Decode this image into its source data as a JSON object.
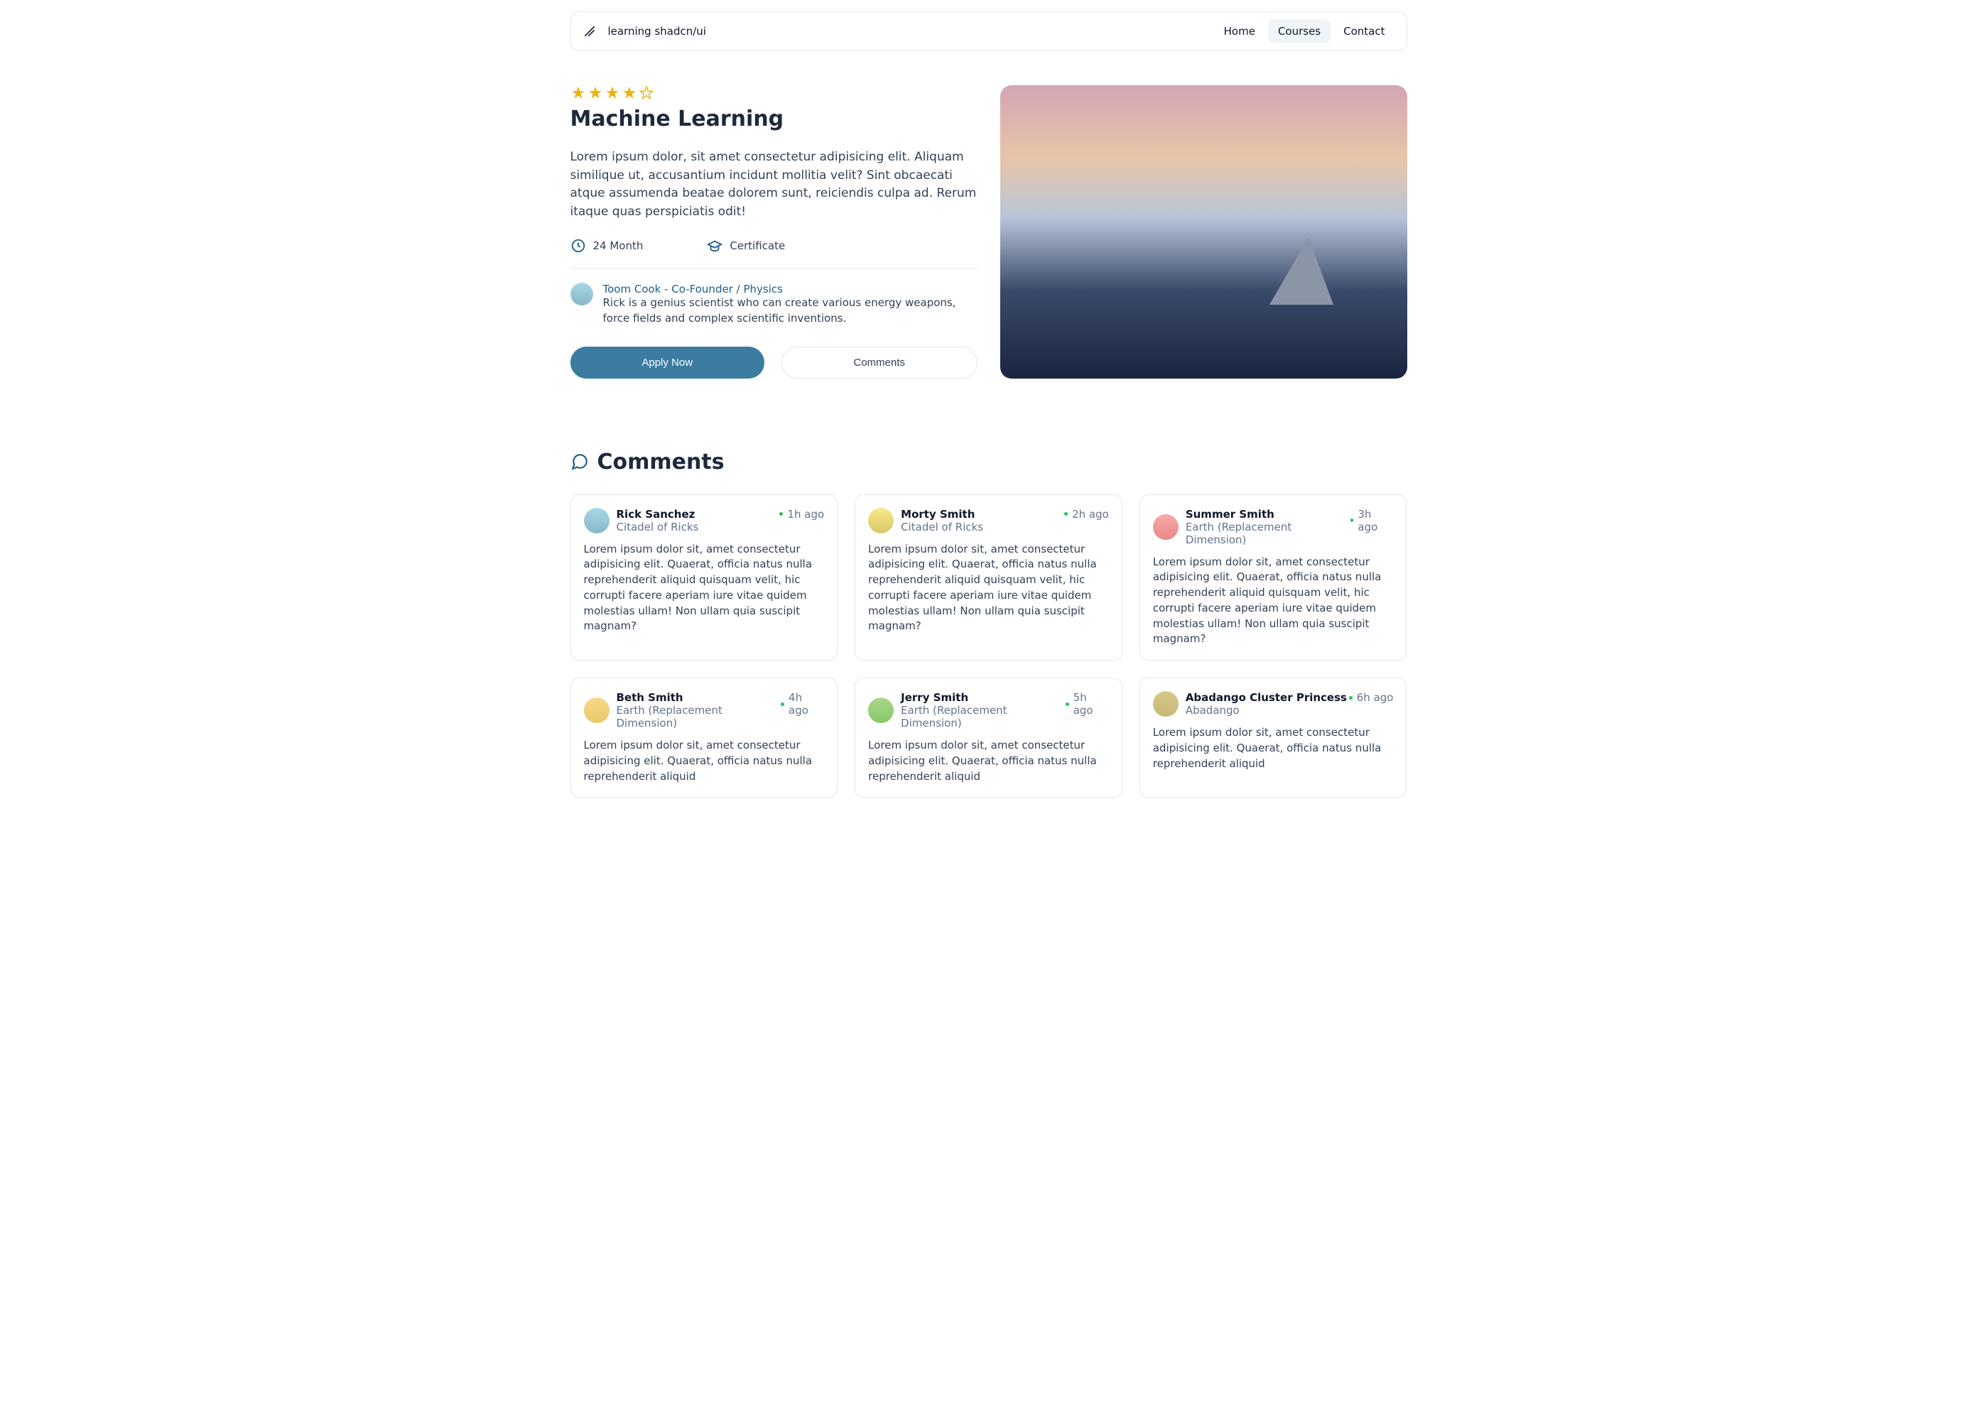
{
  "header": {
    "title": "learning shadcn/ui",
    "nav": [
      {
        "label": "Home",
        "active": false
      },
      {
        "label": "Courses",
        "active": true
      },
      {
        "label": "Contact",
        "active": false
      }
    ]
  },
  "course": {
    "rating": 4,
    "max_rating": 5,
    "title": "Machine Learning",
    "description": "Lorem ipsum dolor, sit amet consectetur adipisicing elit. Aliquam similique ut, accusantium incidunt mollitia velit? Sint obcaecati atque assumenda beatae dolorem sunt, reiciendis culpa ad. Rerum itaque quas perspiciatis odit!",
    "duration": "24 Month",
    "certificate": "Certificate",
    "instructor": {
      "name": "Toom Cook - Co-Founder / Physics",
      "bio": "Rick is a genius scientist who can create various energy weapons, force fields and complex scientific inventions."
    },
    "apply_label": "Apply Now",
    "comments_label": "Comments"
  },
  "comments": {
    "heading": "Comments",
    "items": [
      {
        "name": "Rick Sanchez",
        "location": "Citadel of Ricks",
        "time": "1h ago",
        "avatar_class": "av-rick",
        "body": "Lorem ipsum dolor sit, amet consectetur adipisicing elit. Quaerat, officia natus nulla reprehenderit aliquid quisquam velit, hic corrupti facere aperiam iure vitae quidem molestias ullam! Non ullam quia suscipit magnam?"
      },
      {
        "name": "Morty Smith",
        "location": "Citadel of Ricks",
        "time": "2h ago",
        "avatar_class": "av-morty",
        "body": "Lorem ipsum dolor sit, amet consectetur adipisicing elit. Quaerat, officia natus nulla reprehenderit aliquid quisquam velit, hic corrupti facere aperiam iure vitae quidem molestias ullam! Non ullam quia suscipit magnam?"
      },
      {
        "name": "Summer Smith",
        "location": "Earth (Replacement Dimension)",
        "time": "3h ago",
        "avatar_class": "av-summer",
        "body": "Lorem ipsum dolor sit, amet consectetur adipisicing elit. Quaerat, officia natus nulla reprehenderit aliquid quisquam velit, hic corrupti facere aperiam iure vitae quidem molestias ullam! Non ullam quia suscipit magnam?"
      },
      {
        "name": "Beth Smith",
        "location": "Earth (Replacement Dimension)",
        "time": "4h ago",
        "avatar_class": "av-beth",
        "body": "Lorem ipsum dolor sit, amet consectetur adipisicing elit. Quaerat, officia natus nulla reprehenderit aliquid"
      },
      {
        "name": "Jerry Smith",
        "location": "Earth (Replacement Dimension)",
        "time": "5h ago",
        "avatar_class": "av-jerry",
        "body": "Lorem ipsum dolor sit, amet consectetur adipisicing elit. Quaerat, officia natus nulla reprehenderit aliquid"
      },
      {
        "name": "Abadango Cluster Princess",
        "location": "Abadango",
        "time": "6h ago",
        "avatar_class": "av-aba",
        "body": "Lorem ipsum dolor sit, amet consectetur adipisicing elit. Quaerat, officia natus nulla reprehenderit aliquid"
      }
    ]
  }
}
